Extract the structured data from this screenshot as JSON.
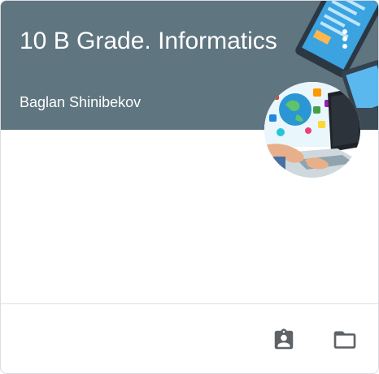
{
  "course": {
    "title": "10 B Grade. Informatics",
    "teacher": "Baglan Shinibekov"
  },
  "header": {
    "background_color": "#5f7580",
    "more_icon": "more-vert-icon"
  },
  "footer": {
    "icons": [
      "assignment-ind-icon",
      "folder-icon"
    ],
    "icon_color": "#5f6368"
  }
}
